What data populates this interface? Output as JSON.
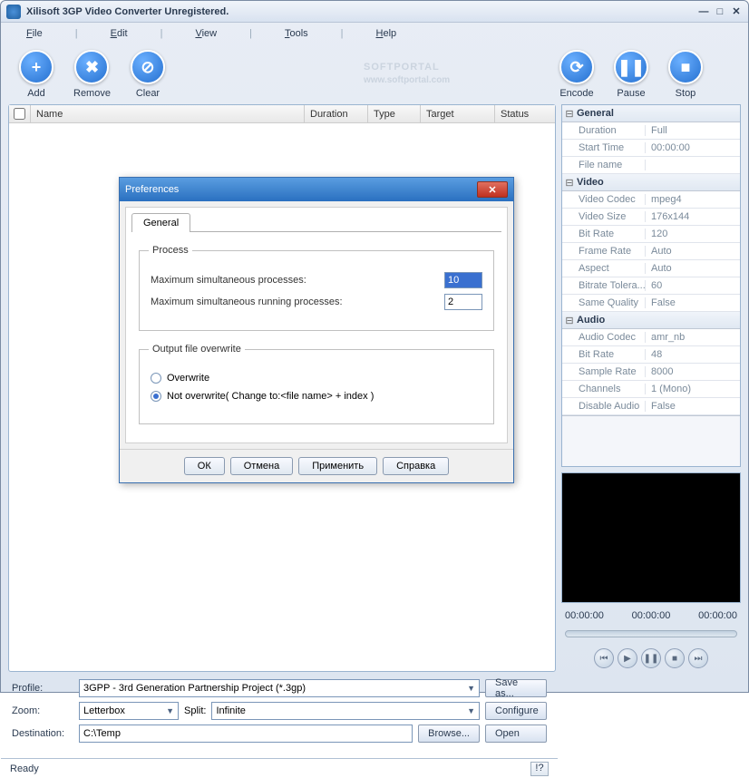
{
  "title": "Xilisoft 3GP Video Converter Unregistered.",
  "menu": {
    "file": "File",
    "edit": "Edit",
    "view": "View",
    "tools": "Tools",
    "help": "Help"
  },
  "toolbar": {
    "add": "Add",
    "remove": "Remove",
    "clear": "Clear",
    "encode": "Encode",
    "pause": "Pause",
    "stop": "Stop"
  },
  "columns": {
    "name": "Name",
    "duration": "Duration",
    "type": "Type",
    "target": "Target",
    "status": "Status"
  },
  "props": {
    "general": {
      "header": "General",
      "duration_k": "Duration",
      "duration_v": "Full",
      "start_k": "Start Time",
      "start_v": "00:00:00",
      "filename_k": "File name",
      "filename_v": ""
    },
    "video": {
      "header": "Video",
      "codec_k": "Video Codec",
      "codec_v": "mpeg4",
      "size_k": "Video Size",
      "size_v": "176x144",
      "bitrate_k": "Bit Rate",
      "bitrate_v": "120",
      "framerate_k": "Frame Rate",
      "framerate_v": "Auto",
      "aspect_k": "Aspect",
      "aspect_v": "Auto",
      "btol_k": "Bitrate Tolera...",
      "btol_v": "60",
      "sameq_k": "Same Quality",
      "sameq_v": "False"
    },
    "audio": {
      "header": "Audio",
      "codec_k": "Audio Codec",
      "codec_v": "amr_nb",
      "bitrate_k": "Bit Rate",
      "bitrate_v": "48",
      "sample_k": "Sample Rate",
      "sample_v": "8000",
      "channels_k": "Channels",
      "channels_v": "1 (Mono)",
      "disable_k": "Disable Audio",
      "disable_v": "False"
    }
  },
  "preview": {
    "t1": "00:00:00",
    "t2": "00:00:00",
    "t3": "00:00:00"
  },
  "bottom": {
    "profile_label": "Profile:",
    "profile_val": "3GPP - 3rd Generation Partnership Project  (*.3gp)",
    "saveas": "Save as...",
    "zoom_label": "Zoom:",
    "zoom_val": "Letterbox",
    "split_label": "Split:",
    "split_val": "Infinite",
    "configure": "Configure",
    "dest_label": "Destination:",
    "dest_val": "C:\\Temp",
    "browse": "Browse...",
    "open": "Open"
  },
  "status": {
    "text": "Ready",
    "help": "!?"
  },
  "dialog": {
    "title": "Preferences",
    "tab": "General",
    "process_legend": "Process",
    "max_sim": "Maximum simultaneous processes:",
    "max_sim_val": "10",
    "max_run": "Maximum simultaneous running processes:",
    "max_run_val": "2",
    "overwrite_legend": "Output file overwrite",
    "overwrite": "Overwrite",
    "not_overwrite": "Not overwrite( Change to:<file name> + index )",
    "btn_ok": "ОК",
    "btn_cancel": "Отмена",
    "btn_apply": "Применить",
    "btn_help": "Справка"
  },
  "watermark": {
    "brand": "SOFTPORTAL",
    "url": "www.softportal.com"
  }
}
